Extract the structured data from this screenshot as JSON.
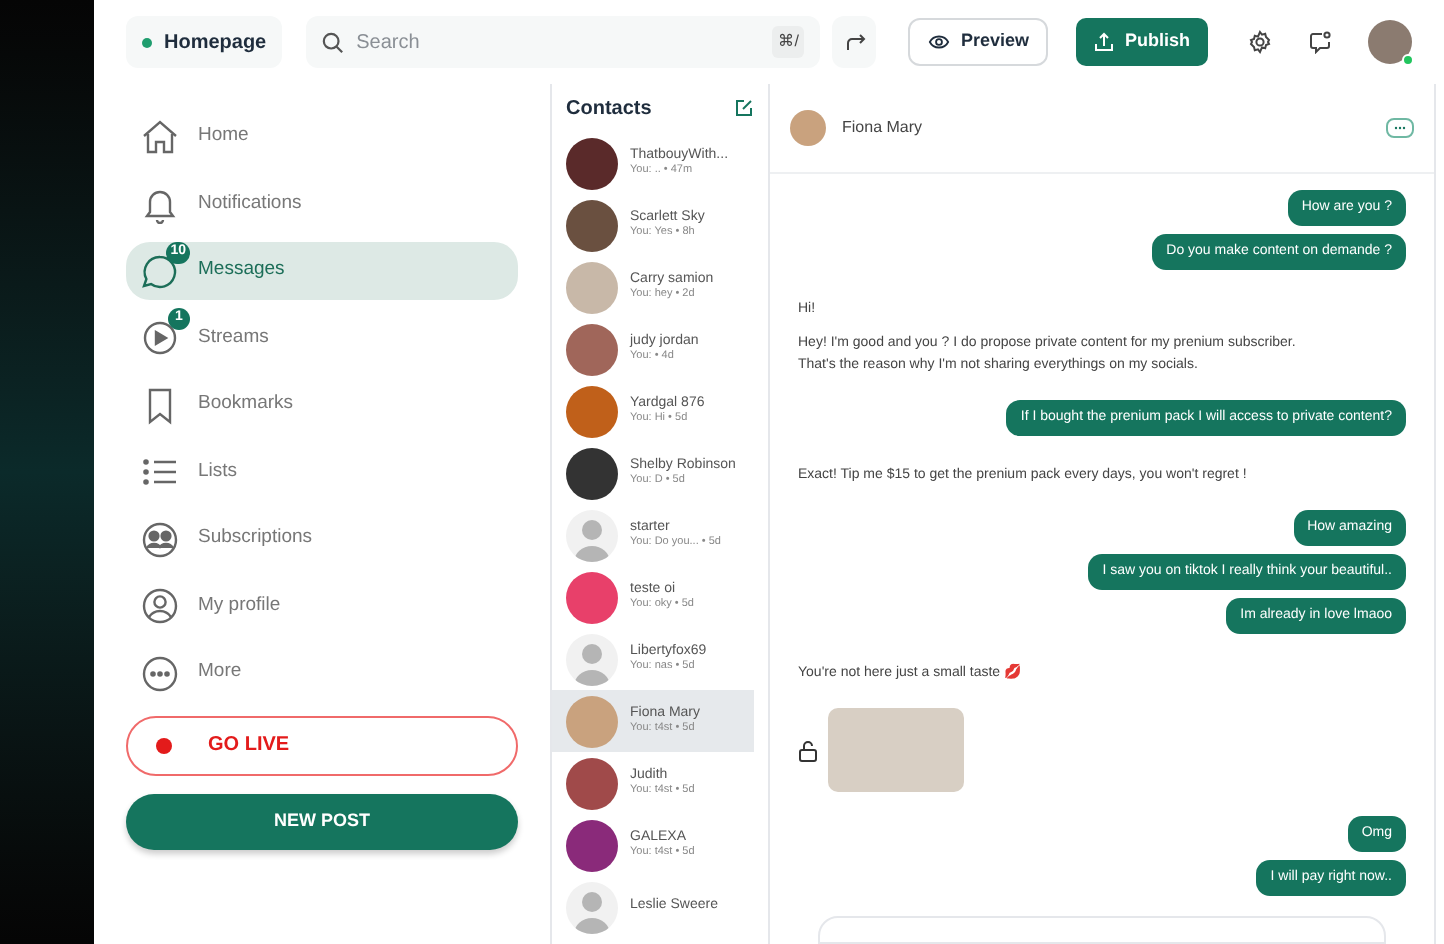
{
  "topbar": {
    "page": "Homepage",
    "search": {
      "placeholder": "Search",
      "shortcut": "⌘/"
    },
    "preview": "Preview",
    "publish": "Publish"
  },
  "sidebar": {
    "items": [
      {
        "label": "Home",
        "selected": false
      },
      {
        "label": "Notifications",
        "selected": false
      },
      {
        "label": "Messages",
        "selected": true,
        "badge": "10"
      },
      {
        "label": "Streams",
        "selected": false,
        "badge": "1"
      },
      {
        "label": "Bookmarks",
        "selected": false
      },
      {
        "label": "Lists",
        "selected": false
      },
      {
        "label": "Subscriptions",
        "selected": false
      },
      {
        "label": "My profile",
        "selected": false
      },
      {
        "label": "More",
        "selected": false
      }
    ],
    "go_live": "GO LIVE",
    "new_post": "NEW POST"
  },
  "contacts": {
    "title": "Contacts",
    "items": [
      {
        "kind": "photo",
        "name": "ThatbouyWith...",
        "preview": "You: .. • 47m",
        "selected": false
      },
      {
        "kind": "photo",
        "name": "Scarlett Sky",
        "preview": "You: Yes • 8h",
        "selected": false
      },
      {
        "kind": "photo",
        "name": "Carry samion",
        "preview": "You: hey • 2d",
        "selected": false
      },
      {
        "kind": "photo",
        "name": "judy jordan",
        "preview": "You: • 4d",
        "selected": false
      },
      {
        "kind": "photo",
        "name": "Yardgal 876",
        "preview": "You: Hi • 5d",
        "selected": false
      },
      {
        "kind": "photo",
        "name": "Shelby Robinson",
        "preview": "You: D • 5d",
        "selected": false
      },
      {
        "kind": "default",
        "name": "starter",
        "preview": "You: Do you... • 5d",
        "selected": false
      },
      {
        "kind": "photo",
        "name": "teste oi",
        "preview": "You: oky • 5d",
        "selected": false
      },
      {
        "kind": "default",
        "name": "Libertyfox69",
        "preview": "You: nas • 5d",
        "selected": false
      },
      {
        "kind": "photo",
        "name": "Fiona Mary",
        "preview": "You: t4st • 5d",
        "selected": true
      },
      {
        "kind": "photo",
        "name": "Judith",
        "preview": "You: t4st • 5d",
        "selected": false
      },
      {
        "kind": "photo",
        "name": "GALEXA",
        "preview": "You: t4st • 5d",
        "selected": false
      },
      {
        "kind": "default",
        "name": "Leslie Sweere",
        "selected": false
      }
    ]
  },
  "chat": {
    "name": "Fiona Mary",
    "messages": [
      {
        "kind": "sent",
        "text": "How are you ?"
      },
      {
        "kind": "sent",
        "text": "Do you make content on demande ?"
      },
      {
        "kind": "received",
        "text": "Hi!"
      },
      {
        "kind": "received",
        "text": "Hey! I'm good and you ? I do propose private content for my prenium subscriber.\nThat's the reason why I'm not sharing everythings on my socials."
      },
      {
        "kind": "sent",
        "text": "If I bought the prenium pack I will access to private content?"
      },
      {
        "kind": "received",
        "text": "Exact! Tip me $15 to get the prenium pack every days, you won't regret !"
      },
      {
        "kind": "sent",
        "text": "How amazing"
      },
      {
        "kind": "sent",
        "text": "I saw you on tiktok I really think your beautiful.."
      },
      {
        "kind": "sent",
        "text": "Im already in love lmaoo"
      },
      {
        "kind": "received",
        "text": "You're not here just a small taste 💋"
      },
      {
        "kind": "image"
      },
      {
        "kind": "sent",
        "text": "Omg"
      },
      {
        "kind": "sent",
        "text": "I will pay right now.."
      }
    ]
  }
}
